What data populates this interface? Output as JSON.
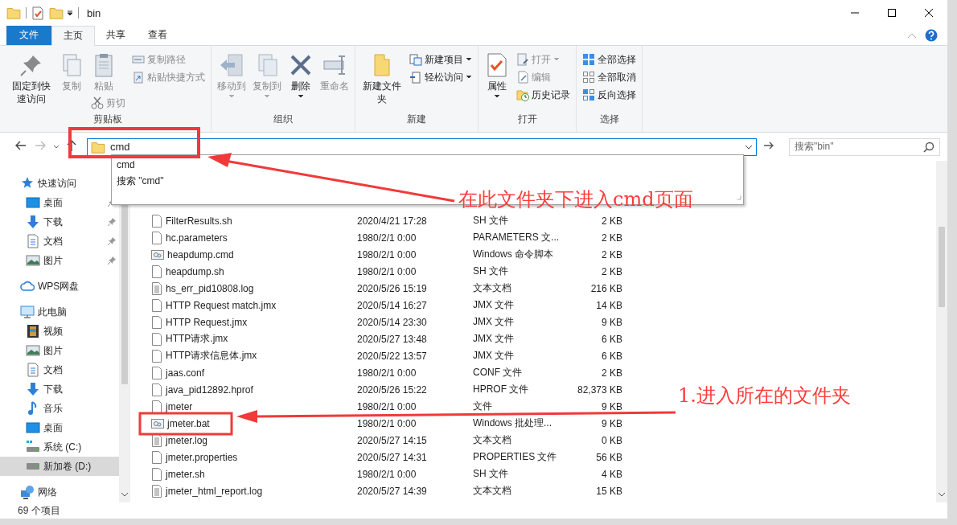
{
  "window": {
    "title": "bin"
  },
  "ribbon_tabs": [
    {
      "label": "文件",
      "kind": "file",
      "selected": false
    },
    {
      "label": "主页",
      "kind": "tab",
      "selected": true
    },
    {
      "label": "共享",
      "kind": "tab",
      "selected": false
    },
    {
      "label": "查看",
      "kind": "tab",
      "selected": false
    }
  ],
  "ribbon": {
    "groups": [
      {
        "label": "剪贴板",
        "columns": [
          [
            {
              "label": "固定到快速访问",
              "kind": "large",
              "disabled": false,
              "menu": false
            }
          ],
          [
            {
              "label": "复制",
              "kind": "large",
              "disabled": true,
              "menu": false
            }
          ],
          [
            {
              "label": "粘贴",
              "kind": "large",
              "disabled": true,
              "menu": false
            },
            {
              "label": "剪切",
              "kind": "small",
              "disabled": true,
              "menu": false
            }
          ],
          [
            {
              "label": "复制路径",
              "kind": "small",
              "disabled": true,
              "menu": false
            },
            {
              "label": "粘贴快捷方式",
              "kind": "small",
              "disabled": true,
              "menu": false
            }
          ]
        ]
      },
      {
        "label": "组织",
        "columns": [
          [
            {
              "label": "移动到",
              "kind": "large",
              "disabled": true,
              "menu": true
            }
          ],
          [
            {
              "label": "复制到",
              "kind": "large",
              "disabled": true,
              "menu": true
            }
          ],
          [
            {
              "label": "删除",
              "kind": "large",
              "disabled": false,
              "menu": true
            }
          ],
          [
            {
              "label": "重命名",
              "kind": "large",
              "disabled": true,
              "menu": false
            }
          ]
        ]
      },
      {
        "label": "新建",
        "columns": [
          [
            {
              "label": "新建文件夹",
              "kind": "large",
              "disabled": false,
              "menu": false
            }
          ],
          [
            {
              "label": "新建项目",
              "kind": "small",
              "disabled": false,
              "menu": true
            },
            {
              "label": "轻松访问",
              "kind": "small",
              "disabled": false,
              "menu": true
            }
          ]
        ]
      },
      {
        "label": "打开",
        "columns": [
          [
            {
              "label": "属性",
              "kind": "large",
              "disabled": false,
              "menu": true
            }
          ],
          [
            {
              "label": "打开",
              "kind": "small",
              "disabled": true,
              "menu": true
            },
            {
              "label": "编辑",
              "kind": "small",
              "disabled": true,
              "menu": false
            },
            {
              "label": "历史记录",
              "kind": "small",
              "disabled": false,
              "menu": false
            }
          ]
        ]
      },
      {
        "label": "选择",
        "columns": [
          [
            {
              "label": "全部选择",
              "kind": "small",
              "disabled": false,
              "menu": false
            },
            {
              "label": "全部取消",
              "kind": "small",
              "disabled": false,
              "menu": false
            },
            {
              "label": "反向选择",
              "kind": "small",
              "disabled": false,
              "menu": false
            }
          ]
        ]
      }
    ]
  },
  "address_bar": {
    "value": "cmd",
    "suggestions": [
      "cmd",
      "搜索 \"cmd\""
    ]
  },
  "search": {
    "placeholder": "搜索\"bin\""
  },
  "sidebar": {
    "items": [
      {
        "label": "快速访问",
        "children": [
          {
            "label": "桌面",
            "pinned": true,
            "selected": false
          },
          {
            "label": "下载",
            "pinned": true,
            "selected": false
          },
          {
            "label": "文档",
            "pinned": true,
            "selected": false
          },
          {
            "label": "图片",
            "pinned": true,
            "selected": false
          }
        ],
        "selected": false
      },
      {
        "label": "WPS网盘",
        "selected": false
      },
      {
        "label": "此电脑",
        "children": [
          {
            "label": "视频",
            "selected": false
          },
          {
            "label": "图片",
            "selected": false
          },
          {
            "label": "文档",
            "selected": false
          },
          {
            "label": "下载",
            "selected": false
          },
          {
            "label": "音乐",
            "selected": false
          },
          {
            "label": "桌面",
            "selected": false
          },
          {
            "label": "系统 (C:)",
            "selected": false
          },
          {
            "label": "新加卷 (D:)",
            "selected": true
          }
        ],
        "selected": false
      },
      {
        "label": "网络",
        "selected": false
      }
    ]
  },
  "files": [
    {
      "name": "FilterResults.sh",
      "date": "2020/4/21 17:28",
      "type": "SH 文件",
      "size": "2 KB",
      "kind": "file"
    },
    {
      "name": "hc.parameters",
      "date": "1980/2/1 0:00",
      "type": "PARAMETERS 文...",
      "size": "2 KB",
      "kind": "file"
    },
    {
      "name": "heapdump.cmd",
      "date": "1980/2/1 0:00",
      "type": "Windows 命令脚本",
      "size": "2 KB",
      "kind": "script"
    },
    {
      "name": "heapdump.sh",
      "date": "1980/2/1 0:00",
      "type": "SH 文件",
      "size": "2 KB",
      "kind": "file"
    },
    {
      "name": "hs_err_pid10808.log",
      "date": "2020/5/26 15:19",
      "type": "文本文档",
      "size": "216 KB",
      "kind": "text"
    },
    {
      "name": "HTTP Request match.jmx",
      "date": "2020/5/14 16:27",
      "type": "JMX 文件",
      "size": "14 KB",
      "kind": "file"
    },
    {
      "name": "HTTP Request.jmx",
      "date": "2020/5/14 23:30",
      "type": "JMX 文件",
      "size": "9 KB",
      "kind": "file"
    },
    {
      "name": "HTTP请求.jmx",
      "date": "2020/5/27 13:48",
      "type": "JMX 文件",
      "size": "6 KB",
      "kind": "file"
    },
    {
      "name": "HTTP请求信息体.jmx",
      "date": "2020/5/22 13:57",
      "type": "JMX 文件",
      "size": "6 KB",
      "kind": "file"
    },
    {
      "name": "jaas.conf",
      "date": "1980/2/1 0:00",
      "type": "CONF 文件",
      "size": "2 KB",
      "kind": "file"
    },
    {
      "name": "java_pid12892.hprof",
      "date": "2020/5/26 15:22",
      "type": "HPROF 文件",
      "size": "82,373 KB",
      "kind": "file"
    },
    {
      "name": "jmeter",
      "date": "1980/2/1 0:00",
      "type": "文件",
      "size": "9 KB",
      "kind": "file"
    },
    {
      "name": "jmeter.bat",
      "date": "1980/2/1 0:00",
      "type": "Windows 批处理...",
      "size": "9 KB",
      "kind": "script"
    },
    {
      "name": "jmeter.log",
      "date": "2020/5/27 14:15",
      "type": "文本文档",
      "size": "0 KB",
      "kind": "text"
    },
    {
      "name": "jmeter.properties",
      "date": "2020/5/27 14:31",
      "type": "PROPERTIES 文件",
      "size": "56 KB",
      "kind": "file"
    },
    {
      "name": "jmeter.sh",
      "date": "1980/2/1 0:00",
      "type": "SH 文件",
      "size": "4 KB",
      "kind": "file"
    },
    {
      "name": "jmeter_html_report.log",
      "date": "2020/5/27 14:39",
      "type": "文本文档",
      "size": "15 KB",
      "kind": "text"
    }
  ],
  "status_bar": {
    "item_count": "69 个项目"
  },
  "annotations": [
    {
      "text": "在此文件夹下进入cmd页面"
    },
    {
      "text": "1.进入所在的文件夹"
    }
  ]
}
